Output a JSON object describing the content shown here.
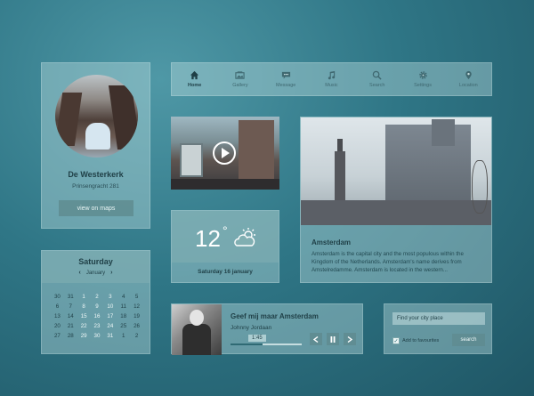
{
  "profile": {
    "name": "De Westerkerk",
    "address": "Prinsengracht 281",
    "map_button": "view on maps"
  },
  "nav": {
    "items": [
      {
        "label": "Home",
        "icon": "home-icon",
        "active": true
      },
      {
        "label": "Gallery",
        "icon": "gallery-icon"
      },
      {
        "label": "Message",
        "icon": "message-icon"
      },
      {
        "label": "Music",
        "icon": "music-icon"
      },
      {
        "label": "Search",
        "icon": "search-icon"
      },
      {
        "label": "Settings",
        "icon": "gear-icon"
      },
      {
        "label": "Location",
        "icon": "location-pin-icon"
      }
    ]
  },
  "weather": {
    "temp": "12",
    "degree": "°",
    "date": "Saturday 16 january",
    "icon": "cloud-sun-icon"
  },
  "city": {
    "title": "Amsterdam",
    "description": "Amsterdam is the capital city and the most populous within the Kingdom of the Netherlands. Amsterdam's name derives from Amstelredamme. Amsterdam is located in the western..."
  },
  "calendar": {
    "day": "Saturday",
    "month": "January",
    "prev": "‹",
    "next": "›",
    "dates": [
      [
        "30",
        "31",
        "1",
        "2",
        "3",
        "4",
        "5"
      ],
      [
        "6",
        "7",
        "8",
        "9",
        "10",
        "11",
        "12"
      ],
      [
        "13",
        "14",
        "15",
        "16",
        "17",
        "18",
        "19"
      ],
      [
        "20",
        "21",
        "22",
        "23",
        "24",
        "25",
        "26"
      ],
      [
        "27",
        "28",
        "29",
        "30",
        "31",
        "1",
        "2"
      ]
    ]
  },
  "player": {
    "song": "Geef mij maar Amsterdam",
    "artist": "Johnny Jordaan",
    "time": "1:45",
    "progress": 0.45,
    "prev_icon": "prev-icon",
    "pause_icon": "pause-icon",
    "next_icon": "next-icon"
  },
  "search": {
    "placeholder": "Find your city place",
    "favourites_label": "Add to favourites",
    "favourites_checked": true,
    "button": "search"
  },
  "colors": {
    "accent": "#5f8c91",
    "text_dark": "#1f3f46",
    "background": "#2f7686"
  }
}
